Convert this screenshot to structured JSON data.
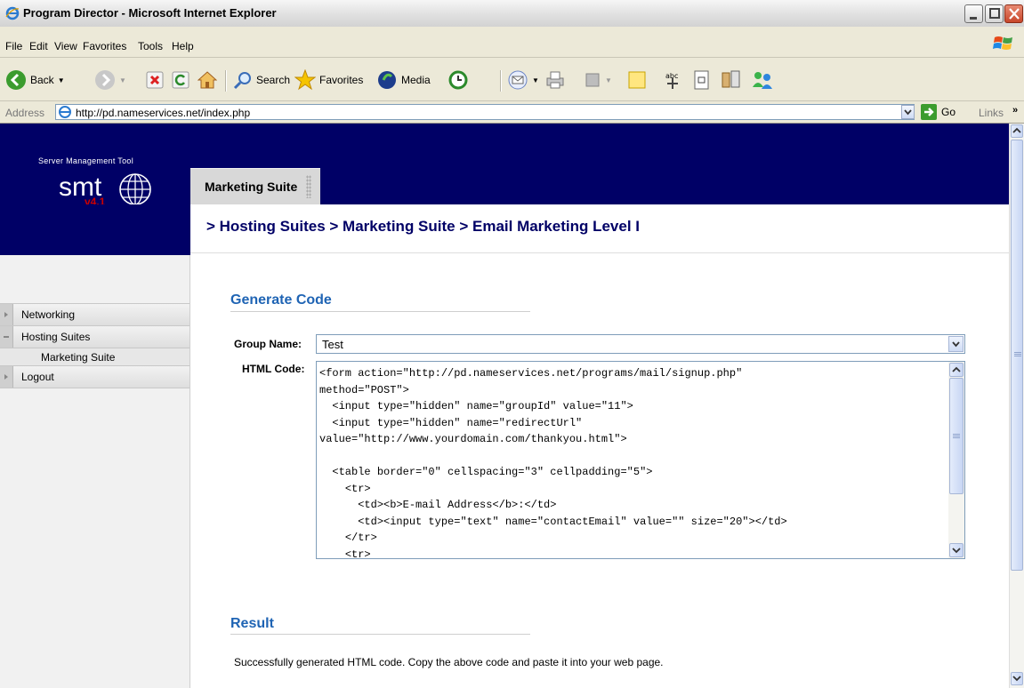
{
  "window": {
    "title": "Program Director - Microsoft Internet Explorer"
  },
  "menu": {
    "items": [
      "File",
      "Edit",
      "View",
      "Favorites",
      "Tools",
      "Help"
    ]
  },
  "toolbar": {
    "back_label": "Back",
    "search_label": "Search",
    "favorites_label": "Favorites",
    "media_label": "Media"
  },
  "address": {
    "label": "Address",
    "url": "http://pd.nameservices.net/index.php",
    "go_label": "Go",
    "links_label": "Links"
  },
  "header": {
    "subtitle": "Server Management Tool",
    "logo_text": "smt",
    "version": "v4.1",
    "tab_label": "Marketing Suite",
    "breadcrumb": "> Hosting Suites > Marketing Suite > Email Marketing Level I"
  },
  "nav": {
    "networking": "Networking",
    "hosting_suites": "Hosting Suites",
    "marketing_suite": "Marketing Suite",
    "logout": "Logout"
  },
  "main": {
    "generate_title": "Generate Code",
    "group_label": "Group Name:",
    "group_value": "Test",
    "html_label": "HTML Code:",
    "html_code": "<form action=\"http://pd.nameservices.net/programs/mail/signup.php\"\nmethod=\"POST\">\n  <input type=\"hidden\" name=\"groupId\" value=\"11\">\n  <input type=\"hidden\" name=\"redirectUrl\"\nvalue=\"http://www.yourdomain.com/thankyou.html\">\n\n  <table border=\"0\" cellspacing=\"3\" cellpadding=\"5\">\n    <tr>\n      <td><b>E-mail Address</b>:</td>\n      <td><input type=\"text\" name=\"contactEmail\" value=\"\" size=\"20\"></td>\n    </tr>\n    <tr>",
    "result_title": "Result",
    "result_text": "Successfully generated HTML code. Copy the above code and paste it into your web page."
  },
  "colors": {
    "header_bg": "#000066",
    "link_blue": "#1f64b4",
    "version_red": "#cc0000"
  }
}
